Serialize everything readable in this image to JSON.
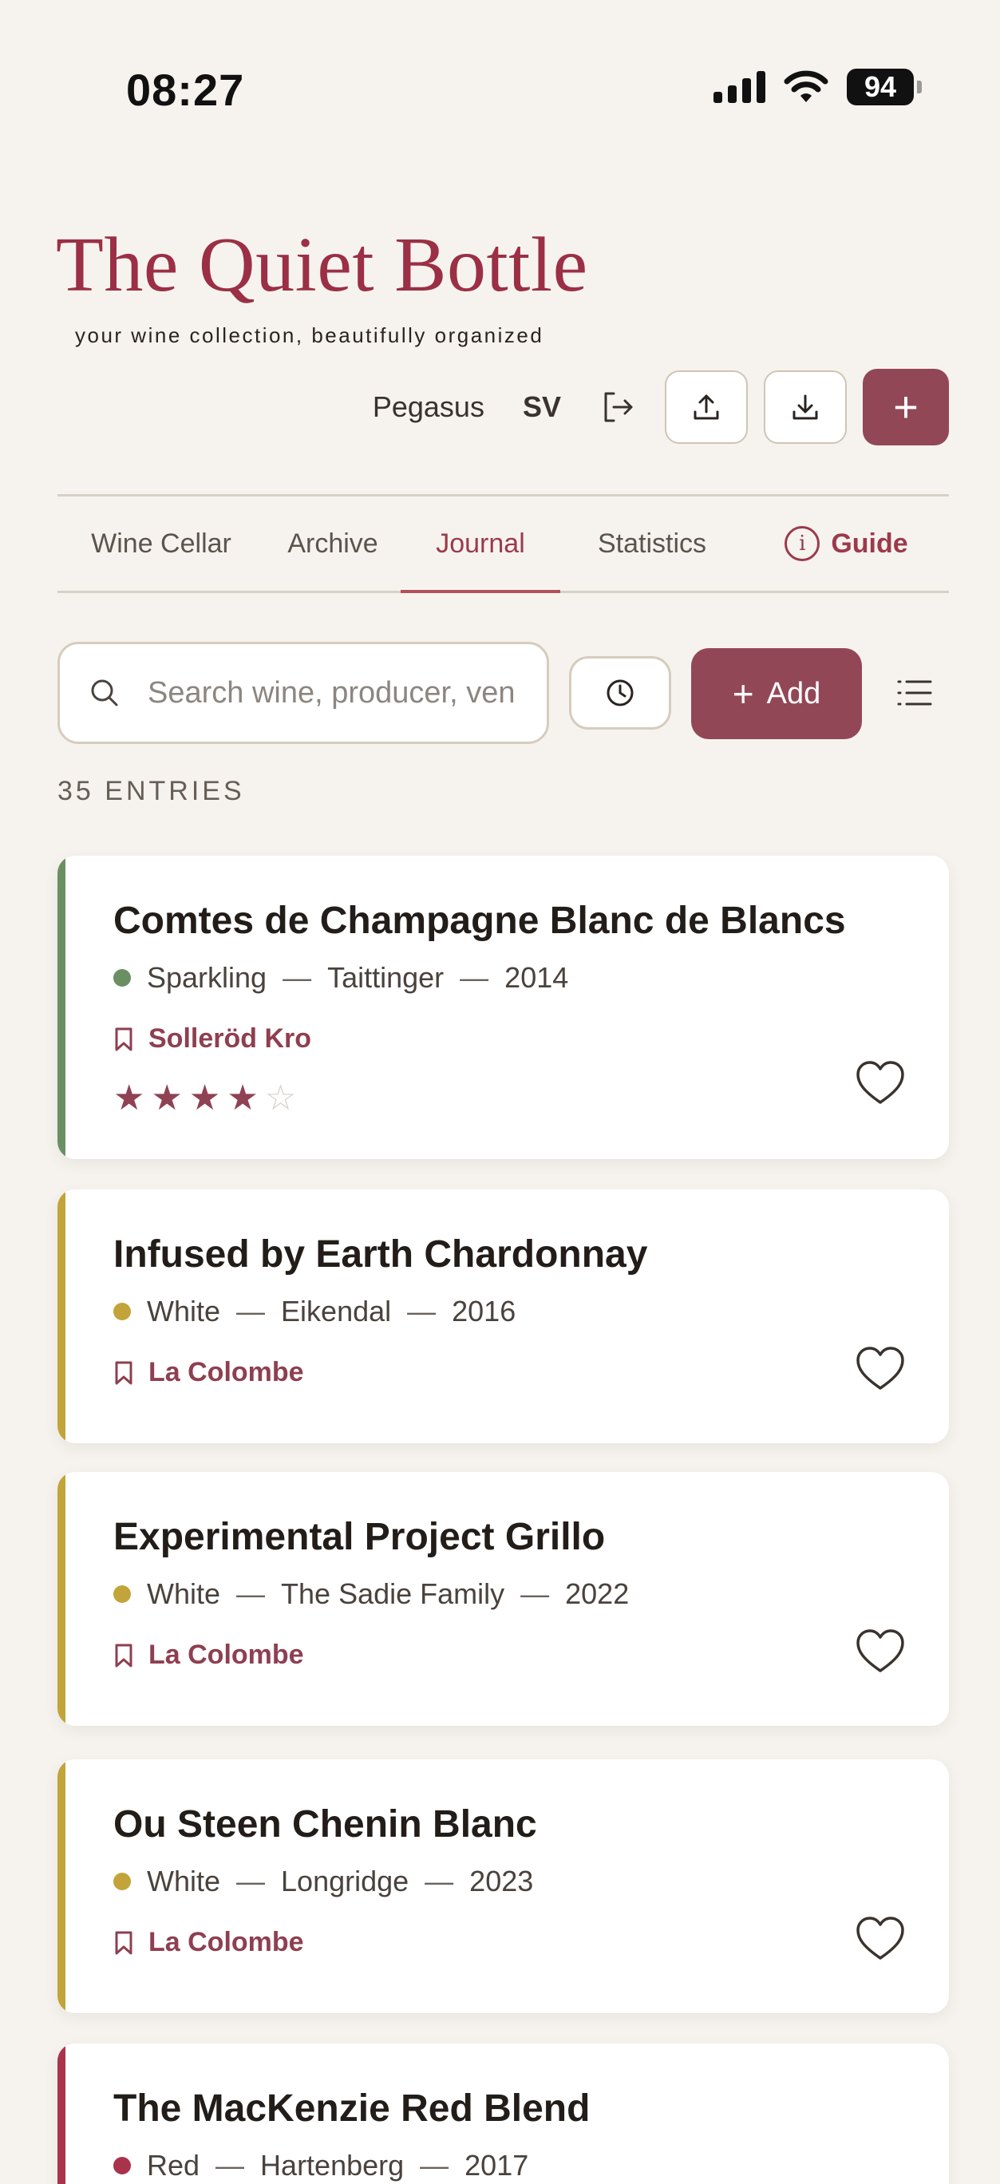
{
  "status_bar": {
    "time": "08:27",
    "battery": "94"
  },
  "header": {
    "title": "The Quiet Bottle",
    "subtitle": "your wine collection, beautifully organized",
    "user": "Pegasus",
    "language": "SV",
    "new_label": "+"
  },
  "tabs": [
    {
      "label": "Wine Cellar",
      "active": false
    },
    {
      "label": "Archive",
      "active": false
    },
    {
      "label": "Journal",
      "active": true
    },
    {
      "label": "Statistics",
      "active": false
    },
    {
      "label": "Guide",
      "active": false
    }
  ],
  "toolbar": {
    "search_placeholder": "Search wine, producer, venue",
    "add_label": "Add"
  },
  "entries_label": "35 ENTRIES",
  "colors": {
    "brand": "#9b2f45",
    "button": "#924757",
    "sparkling": "#6a8f63",
    "white": "#c2a43a",
    "red": "#a8334a"
  },
  "entries": [
    {
      "name": "Comtes de Champagne Blanc de Blancs",
      "type": "Sparkling",
      "producer": "Taittinger",
      "year": "2014",
      "venue": "Solleröd Kro",
      "rating": 4,
      "rating_max": 5,
      "color": "#6a8f63"
    },
    {
      "name": "Infused by Earth Chardonnay",
      "type": "White",
      "producer": "Eikendal",
      "year": "2016",
      "venue": "La Colombe",
      "color": "#c2a43a"
    },
    {
      "name": "Experimental Project Grillo",
      "type": "White",
      "producer": "The Sadie Family",
      "year": "2022",
      "venue": "La Colombe",
      "color": "#c2a43a"
    },
    {
      "name": "Ou Steen Chenin Blanc",
      "type": "White",
      "producer": "Longridge",
      "year": "2023",
      "venue": "La Colombe",
      "color": "#c2a43a"
    },
    {
      "name": "The MacKenzie Red Blend",
      "type": "Red",
      "producer": "Hartenberg",
      "year": "2017",
      "color": "#a8334a"
    }
  ]
}
